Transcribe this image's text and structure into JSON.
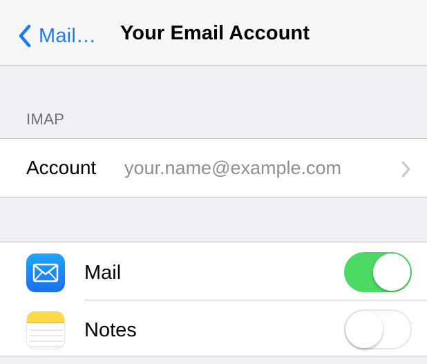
{
  "nav": {
    "back_label": "Mail…",
    "title": "Your Email Account"
  },
  "section_header": "IMAP",
  "account": {
    "label": "Account",
    "value": "your.name@example.com"
  },
  "apps": [
    {
      "label": "Mail",
      "icon": "mail-app-icon",
      "enabled": true
    },
    {
      "label": "Notes",
      "icon": "notes-app-icon",
      "enabled": false
    }
  ],
  "colors": {
    "accent": "#1a7cf5",
    "toggle_on": "#4cd964",
    "background": "#efeff4"
  }
}
